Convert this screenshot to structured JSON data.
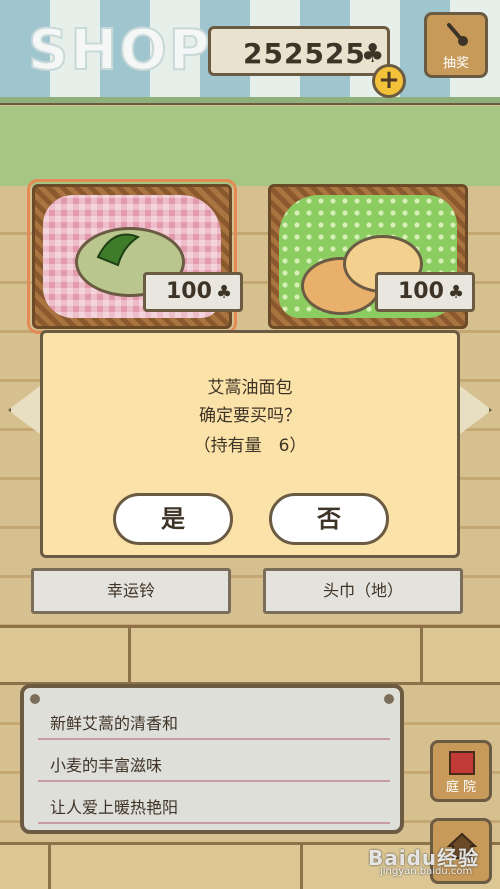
{
  "header": {
    "shop_title": "SHOP",
    "clover_count": "252525",
    "clover_icon": "clover-icon",
    "add_button": "+",
    "lottery_label": "抽奖"
  },
  "products": [
    {
      "price": "100",
      "label": "幸运铃",
      "selected": true
    },
    {
      "price": "100",
      "label": "头巾（地）",
      "selected": false
    }
  ],
  "dialog": {
    "item_name": "艾蒿油面包",
    "question": "确定要买吗？",
    "owned": "（持有量　6）",
    "yes_label": "是",
    "no_label": "否"
  },
  "description": {
    "lines": [
      "新鲜艾蒿的清香和",
      "小麦的丰富滋味",
      "让人爱上暖热艳阳"
    ]
  },
  "side_buttons": {
    "garden_label": "庭 院"
  },
  "watermark": {
    "brand": "Baidu经验",
    "url": "jingyan.baidu.com"
  },
  "colors": {
    "dialog_bg": "#fbe2a9",
    "awning_blue": "#9fc6cf",
    "wood": "#d7c08f"
  }
}
